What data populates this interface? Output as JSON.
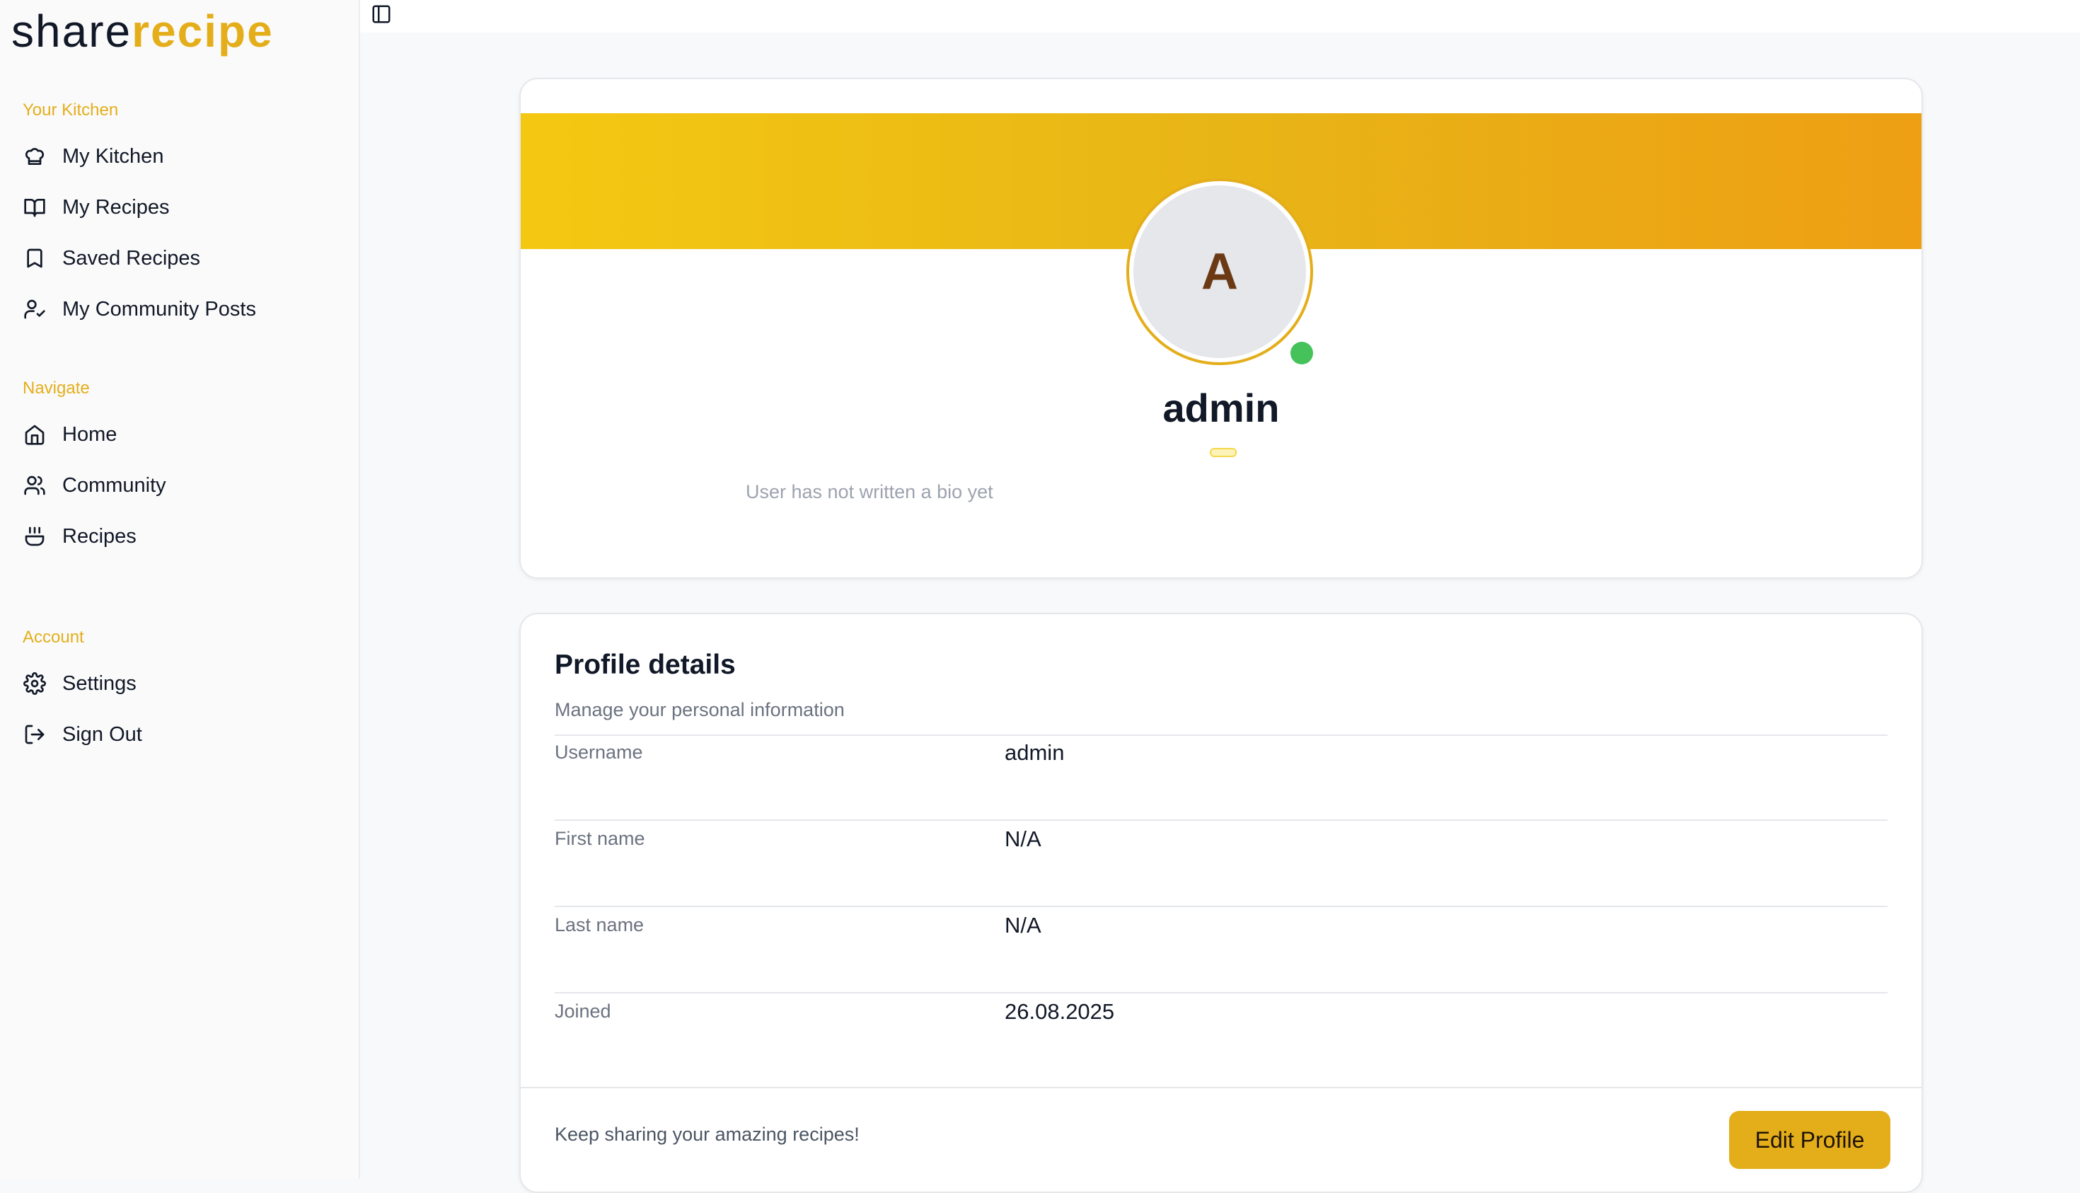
{
  "brand": {
    "part1": "share",
    "part2": "recipe"
  },
  "sidebar": {
    "sections": [
      {
        "label": "Your Kitchen",
        "items": [
          {
            "label": "My Kitchen",
            "icon": "chef-hat-icon"
          },
          {
            "label": "My Recipes",
            "icon": "open-book-icon"
          },
          {
            "label": "Saved Recipes",
            "icon": "bookmark-icon"
          },
          {
            "label": "My Community Posts",
            "icon": "user-check-icon"
          }
        ]
      },
      {
        "label": "Navigate",
        "items": [
          {
            "label": "Home",
            "icon": "home-icon"
          },
          {
            "label": "Community",
            "icon": "users-icon"
          },
          {
            "label": "Recipes",
            "icon": "cooking-pot-icon"
          }
        ]
      },
      {
        "label": "Account",
        "items": [
          {
            "label": "Settings",
            "icon": "gear-icon"
          },
          {
            "label": "Sign Out",
            "icon": "sign-out-icon"
          }
        ]
      }
    ]
  },
  "profile": {
    "avatar_initial": "A",
    "name": "admin",
    "bio": "User has not written a bio yet",
    "online": true
  },
  "details": {
    "title": "Profile details",
    "subtitle": "Manage your personal information",
    "rows": [
      {
        "label": "Username",
        "value": "admin"
      },
      {
        "label": "First name",
        "value": "N/A"
      },
      {
        "label": "Last name",
        "value": "N/A"
      },
      {
        "label": "Joined",
        "value": "26.08.2025"
      }
    ],
    "footer_text": "Keep sharing your amazing recipes!",
    "edit_button": "Edit Profile"
  },
  "colors": {
    "accent": "#e4ae1b",
    "online": "#45c25a",
    "avatar_letter": "#6b3a14"
  }
}
